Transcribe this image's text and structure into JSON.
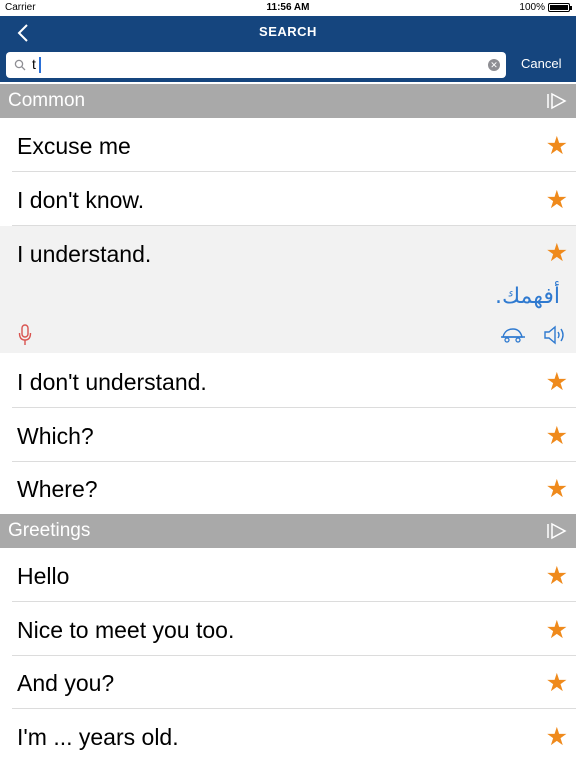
{
  "status": {
    "carrier": "Carrier",
    "time": "11:56 AM",
    "battery": "100%"
  },
  "header": {
    "title": "SEARCH"
  },
  "search": {
    "value": "t",
    "cancel_label": "Cancel"
  },
  "sections": [
    {
      "title": "Common",
      "items": [
        {
          "phrase": "Excuse me"
        },
        {
          "phrase": "I don't know."
        },
        {
          "phrase": "I understand.",
          "translation": "أفهمك."
        },
        {
          "phrase": "I don't understand."
        },
        {
          "phrase": "Which?"
        },
        {
          "phrase": "Where?"
        }
      ]
    },
    {
      "title": "Greetings",
      "items": [
        {
          "phrase": "Hello"
        },
        {
          "phrase": "Nice to meet you too."
        },
        {
          "phrase": "And you?"
        },
        {
          "phrase": "I'm ... years old."
        }
      ]
    }
  ],
  "icons": {
    "star": "star-icon",
    "mic": "microphone-icon",
    "slow": "turtle-icon",
    "speaker": "speaker-icon",
    "play": "play-all-icon"
  },
  "colors": {
    "nav": "#15457e",
    "star": "#ef8a1c",
    "accent_text": "#2f7ad0",
    "mic": "#d9534f",
    "section": "#a9a9a9"
  }
}
